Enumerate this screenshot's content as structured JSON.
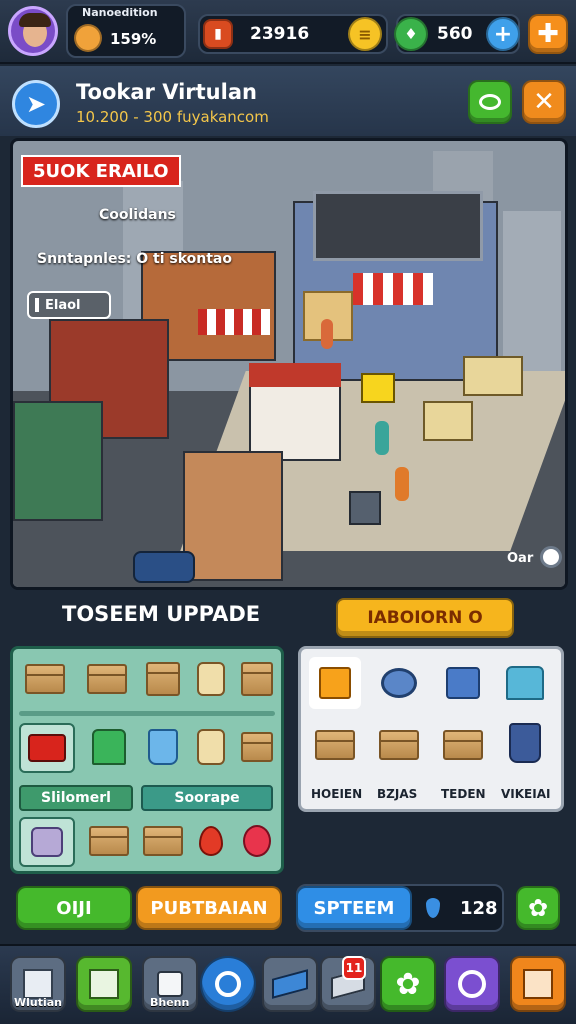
{
  "topbar": {
    "player_label": "Nanoedition",
    "player_percent": "159%",
    "cash": "23916",
    "gems": "560"
  },
  "header": {
    "title": "Tookar Virtulan",
    "subtitle": "10.200 - 300 fuyakancom"
  },
  "scene": {
    "banner": "5UOK ERAILO",
    "label_1": "Coolidans",
    "label_2": "Snntapnles: O ti skontao",
    "label_3": "Elaol",
    "corner_label": "Oar"
  },
  "upgrade": {
    "title": "TOSEEM UPPADE",
    "action_button": "IABOIORN O",
    "tab_1": "Slilomerl",
    "tab_2": "Soorape"
  },
  "inventory_labels": [
    "HOEIEN",
    "BZJAS",
    "TEDEN",
    "VIKEIAI"
  ],
  "actions": {
    "button_1": "OIJI",
    "button_2": "PUBTBAIAN",
    "button_3": "SPTEEM",
    "count": "128"
  },
  "nav": {
    "item_1_label": "Wlutian",
    "item_3_label": "Bhenn",
    "badge": "11"
  },
  "colors": {
    "green": "#43b82e",
    "orange": "#f29a1f",
    "blue": "#2f8ee6",
    "yellow": "#f6b51d",
    "red": "#d8241c"
  }
}
